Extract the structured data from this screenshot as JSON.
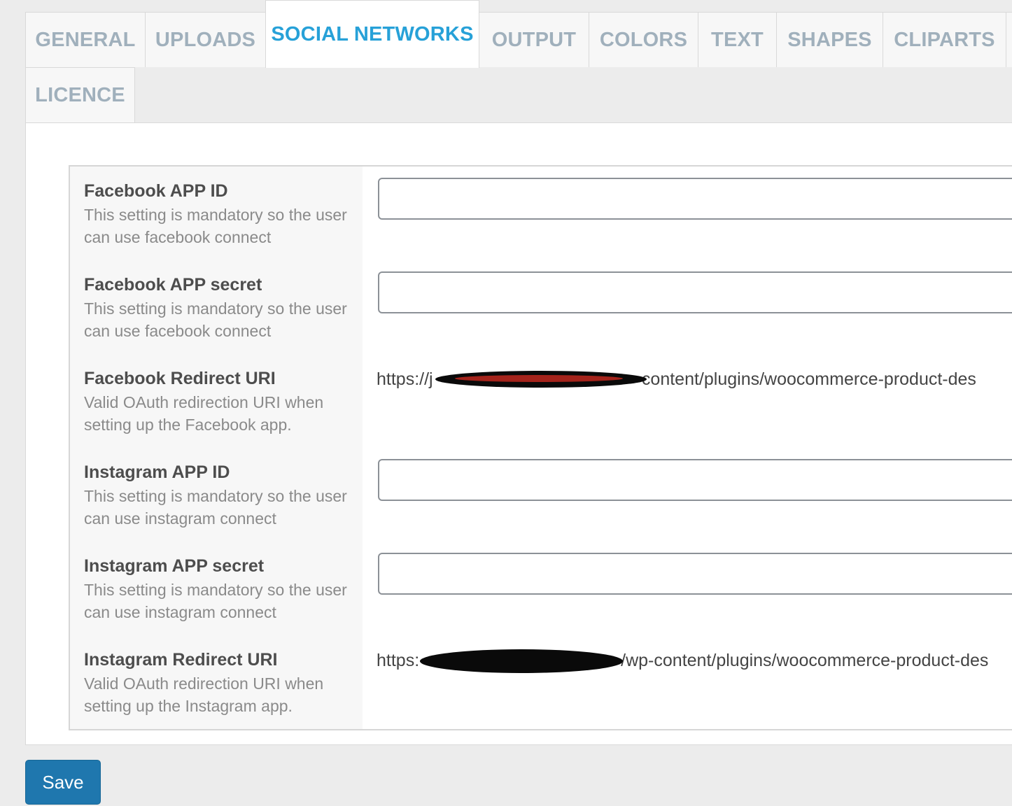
{
  "tabs": [
    {
      "label": "GENERAL",
      "active": false
    },
    {
      "label": "UPLOADS",
      "active": false
    },
    {
      "label": "SOCIAL NETWORKS",
      "active": true
    },
    {
      "label": "OUTPUT",
      "active": false
    },
    {
      "label": "COLORS",
      "active": false
    },
    {
      "label": "TEXT",
      "active": false
    },
    {
      "label": "SHAPES",
      "active": false
    },
    {
      "label": "CLIPARTS",
      "active": false
    },
    {
      "label": "LICENCE",
      "active": false
    }
  ],
  "settings": {
    "facebook_app_id": {
      "title": "Facebook APP ID",
      "description": "This setting is mandatory so the user can use facebook connect",
      "value": ""
    },
    "facebook_app_secret": {
      "title": "Facebook APP secret",
      "description": "This setting is mandatory so the user can use facebook connect",
      "value": ""
    },
    "facebook_redirect_uri": {
      "title": "Facebook Redirect URI",
      "description": "Valid OAuth redirection URI when setting up the Facebook app.",
      "uri_prefix": "https://j",
      "uri_suffix": "-content/plugins/woocommerce-product-des"
    },
    "instagram_app_id": {
      "title": "Instagram APP ID",
      "description": "This setting is mandatory so the user can use instagram connect",
      "value": ""
    },
    "instagram_app_secret": {
      "title": "Instagram APP secret",
      "description": "This setting is mandatory so the user can use instagram connect",
      "value": ""
    },
    "instagram_redirect_uri": {
      "title": "Instagram Redirect URI",
      "description": "Valid OAuth redirection URI when setting up the Instagram app.",
      "uri_prefix": "https:",
      "uri_suffix": "/wp-content/plugins/woocommerce-product-des"
    }
  },
  "save_label": "Save",
  "colors": {
    "active_tab": "#27a1d8",
    "inactive_tab": "#a0b0bc",
    "save_button": "#1f77ae",
    "redaction_black": "#0a0a0a",
    "redaction_red": "#c0281e"
  }
}
